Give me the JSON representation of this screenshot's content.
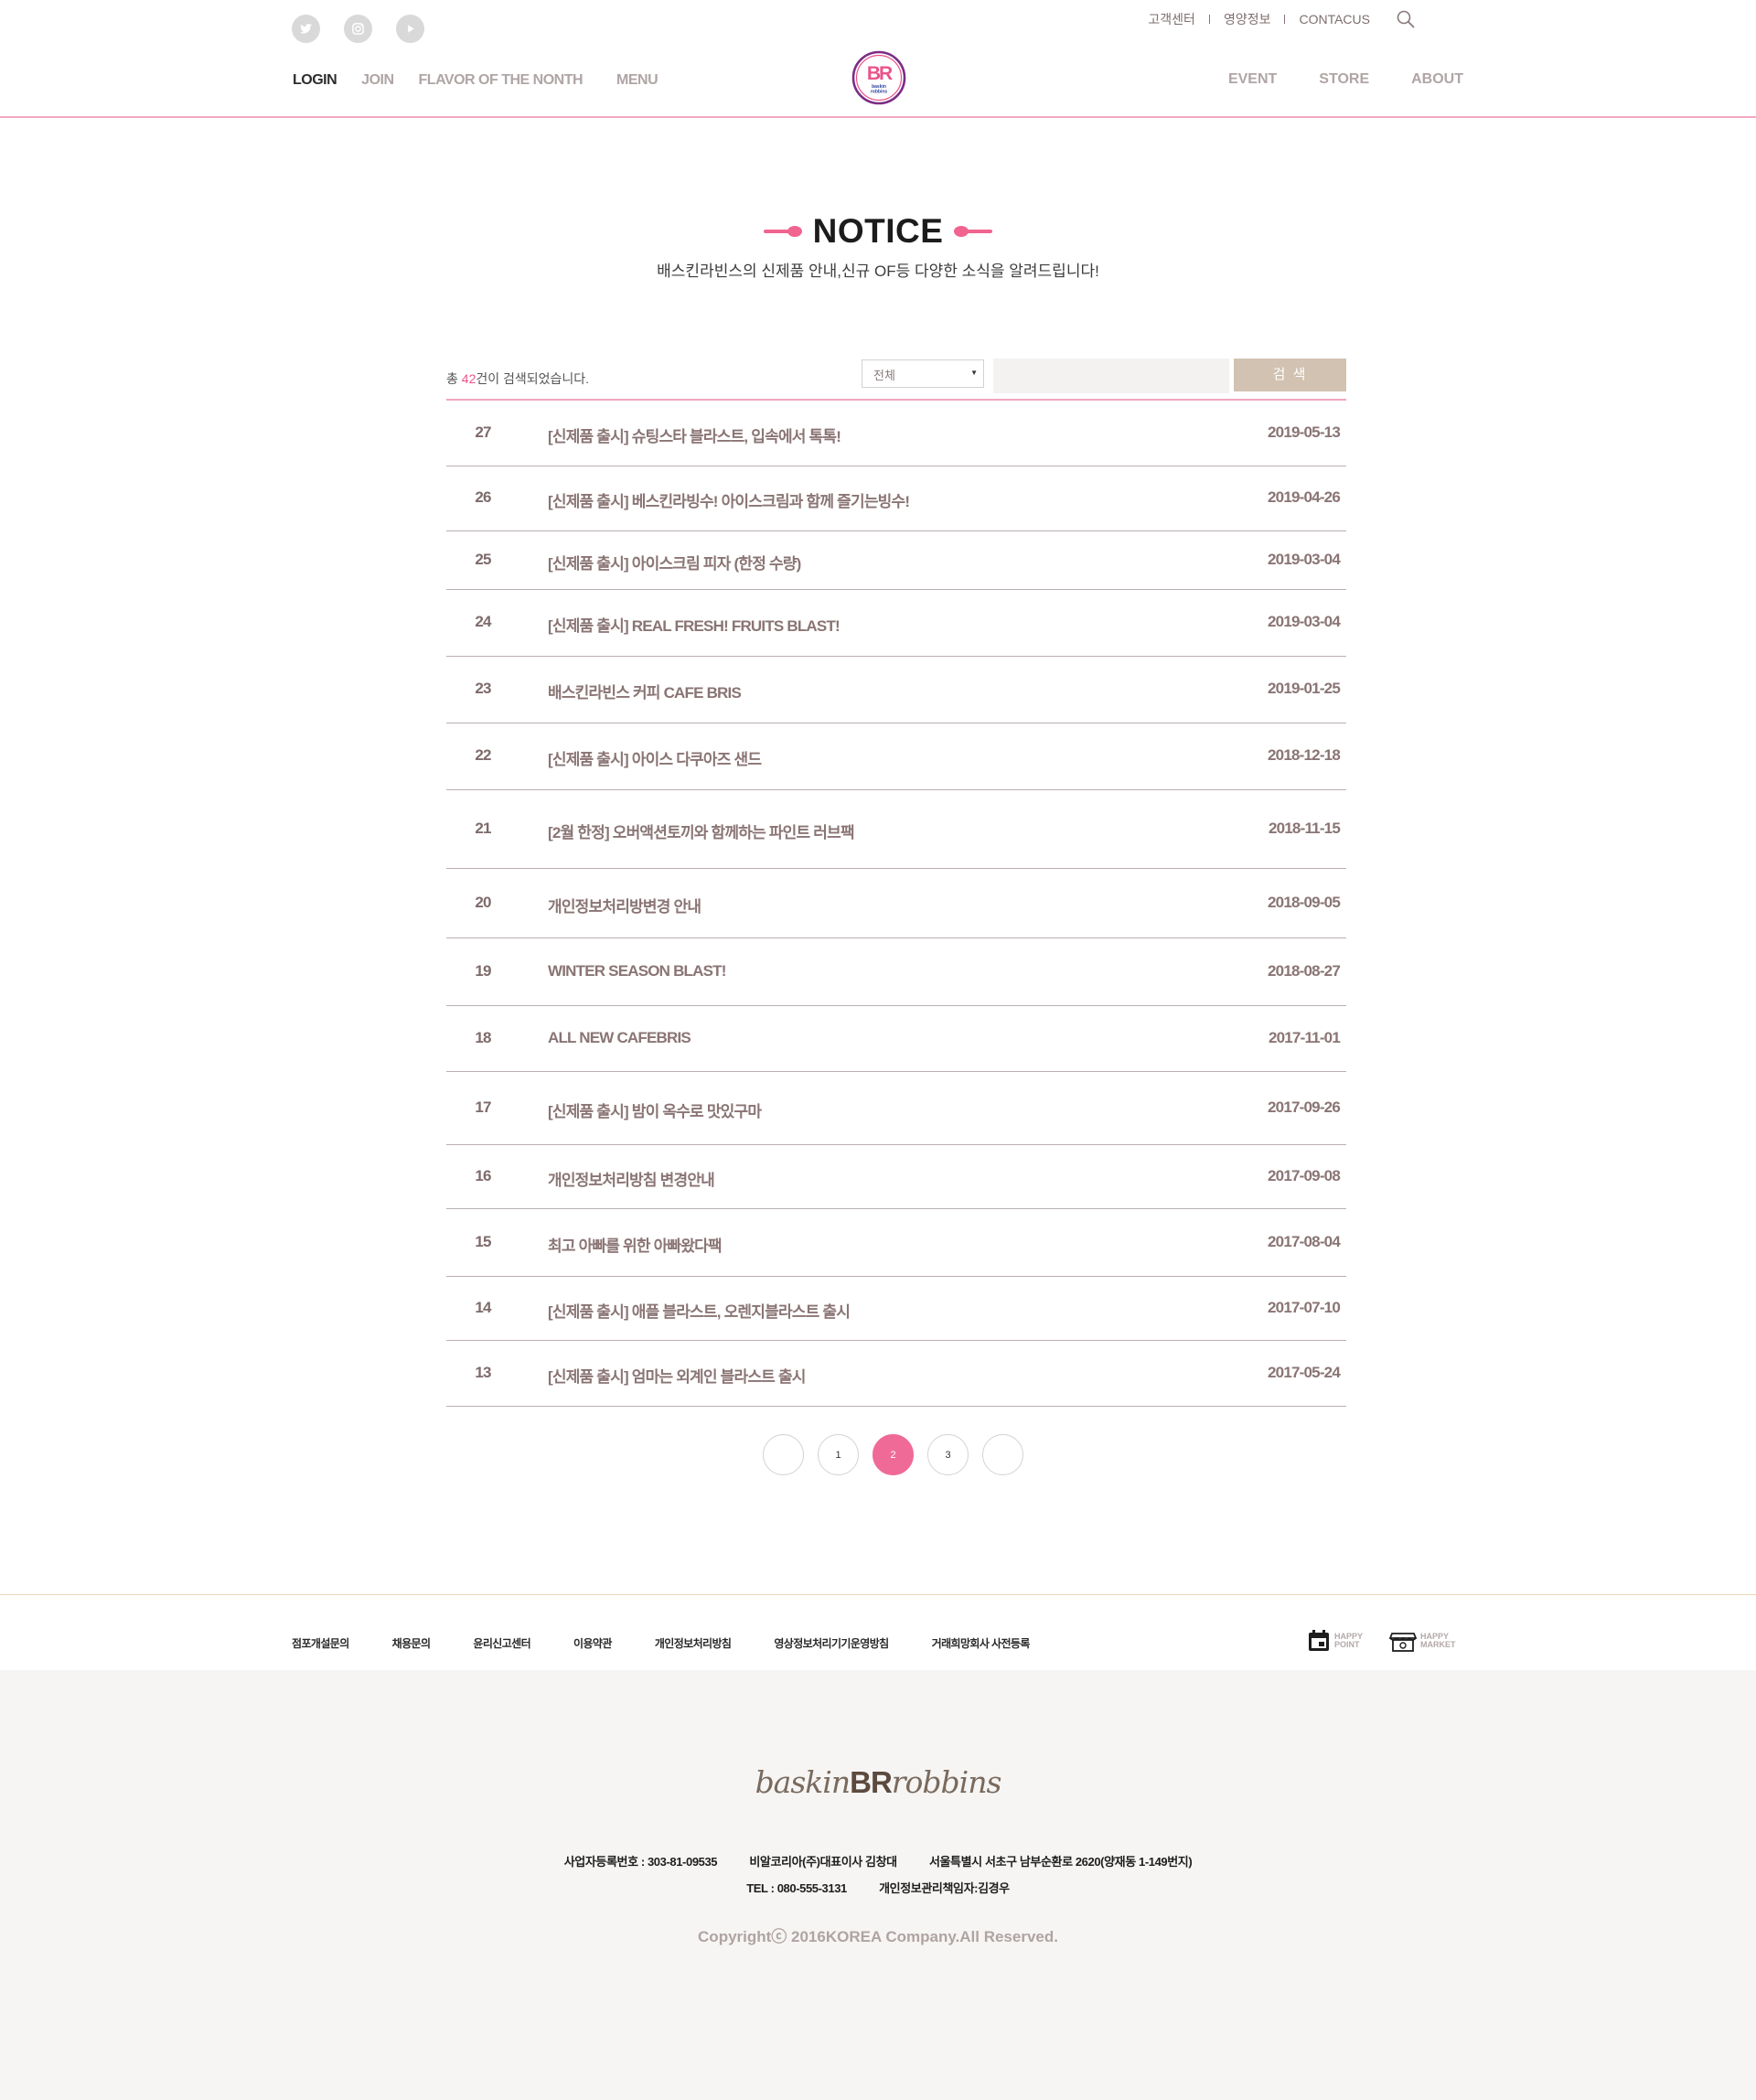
{
  "header": {
    "util_links": [
      "고객센터",
      "영양정보",
      "CONTACUS"
    ],
    "nav_left": [
      "LOGIN",
      "JOIN",
      "FLAVOR OF THE NONTH",
      "MENU"
    ],
    "nav_right": [
      "EVENT",
      "STORE",
      "ABOUT"
    ],
    "logo_text": "BR"
  },
  "notice": {
    "title": "NOTICE",
    "subtitle": "배스킨라빈스의 신제품 안내,신규 OF등 다양한 소식을 알려드립니다!"
  },
  "list_top": {
    "total_prefix": "총 ",
    "total_count": "42",
    "total_suffix": "건이 검색되었습니다.",
    "select_value": "전체",
    "search_placeholder": "",
    "search_button": "검 색"
  },
  "notices": [
    {
      "no": "27",
      "title": "[신제품 출시] 슈팅스타 블라스트, 입속에서 톡톡!",
      "date": "2019-05-13"
    },
    {
      "no": "26",
      "title": "[신제품 출시] 베스킨라빙수! 아이스크림과 함께 즐기는빙수!",
      "date": "2019-04-26"
    },
    {
      "no": "25",
      "title": "[신제품 출시] 아이스크림 피자 (한정 수량)",
      "date": "2019-03-04"
    },
    {
      "no": "24",
      "title": "[신제품 출시] REAL FRESH! FRUITS BLAST!",
      "date": "2019-03-04"
    },
    {
      "no": "23",
      "title": "배스킨라빈스 커피 CAFE BRIS",
      "date": "2019-01-25"
    },
    {
      "no": "22",
      "title": "[신제품 출시] 아이스 다쿠아즈 샌드",
      "date": "2018-12-18"
    },
    {
      "no": "21",
      "title": "[2월 한정] 오버액션토끼와 함께하는 파인트 러브팩",
      "date": "2018-11-15"
    },
    {
      "no": "20",
      "title": "개인정보처리방변경 안내",
      "date": "2018-09-05"
    },
    {
      "no": "19",
      "title": "WINTER SEASON BLAST!",
      "date": "2018-08-27"
    },
    {
      "no": "18",
      "title": "ALL NEW CAFEBRIS",
      "date": "2017-11-01"
    },
    {
      "no": "17",
      "title": "[신제품 출시] 밤이 옥수로 맛있구마",
      "date": "2017-09-26"
    },
    {
      "no": "16",
      "title": "개인정보처리방침 변경안내",
      "date": "2017-09-08"
    },
    {
      "no": "15",
      "title": "최고 아빠를 위한 아빠왔다팩",
      "date": "2017-08-04"
    },
    {
      "no": "14",
      "title": "[신제품 출시] 애플 블라스트, 오렌지블라스트 출시",
      "date": "2017-07-10"
    },
    {
      "no": "13",
      "title": "[신제품 출시] 엄마는 외계인 블라스트 출시",
      "date": "2017-05-24"
    }
  ],
  "pagination": {
    "prev": "",
    "pages": [
      "1",
      "2",
      "3"
    ],
    "current": "2",
    "next": ""
  },
  "footer": {
    "links": [
      "점포개설문의",
      "채용문의",
      "윤리신고센터",
      "이용약관",
      "개인정보처리방침",
      "영상정보처리기기운영방침",
      "거래희망회사 사전등록"
    ],
    "happy_point": [
      "HAPPY",
      "POINT"
    ],
    "happy_market": [
      "HAPPY",
      "MARKET"
    ],
    "logo_pre": "baskin",
    "logo_mid": "BR",
    "logo_post": "robbins",
    "info_line1": [
      "사업자등록번호 : 303-81-09535",
      "비알코리아(주)대표이사 김창대",
      "서울특별시 서초구 남부순환로 2620(양재동 1-149번지)"
    ],
    "info_line2": [
      "TEL : 080-555-3131",
      "개인정보관리책임자:김경우"
    ],
    "copyright": "Copyrightⓒ 2016KOREA Company.All Reserved."
  },
  "colors": {
    "accent": "#f06a97",
    "brown": "#8a7474",
    "button": "#d2c2b2"
  }
}
